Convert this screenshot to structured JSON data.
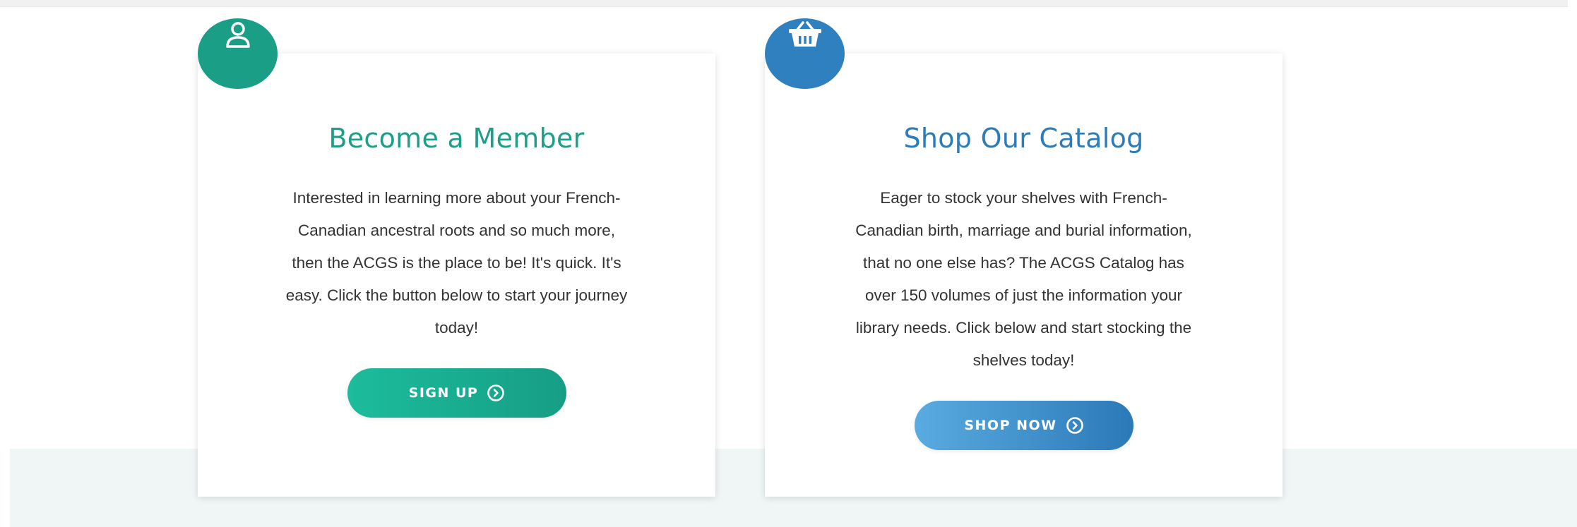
{
  "cards": {
    "member": {
      "icon": "user-icon",
      "title": "Become a Member",
      "text": "Interested in learning more about your French-Canadian ancestral roots and so much more, then the ACGS is the place to be! It's quick. It's easy. Click the button below to start your journey today!",
      "button_label": "SIGN UP",
      "button_icon": "circle-arrow-right-icon",
      "accent_color": "#1a9e85"
    },
    "catalog": {
      "icon": "shopping-basket-icon",
      "title": "Shop Our Catalog",
      "text": "Eager to stock your shelves with French-Canadian birth, marriage and burial information, that no one else has? The ACGS Catalog has over 150 volumes of just the information your library needs. Click below and start stocking the shelves today!",
      "button_label": "SHOP NOW",
      "button_icon": "circle-arrow-right-icon",
      "accent_color": "#2f80bf"
    }
  },
  "colors": {
    "band_background": "#f0f6f6",
    "body_text": "#333333"
  }
}
